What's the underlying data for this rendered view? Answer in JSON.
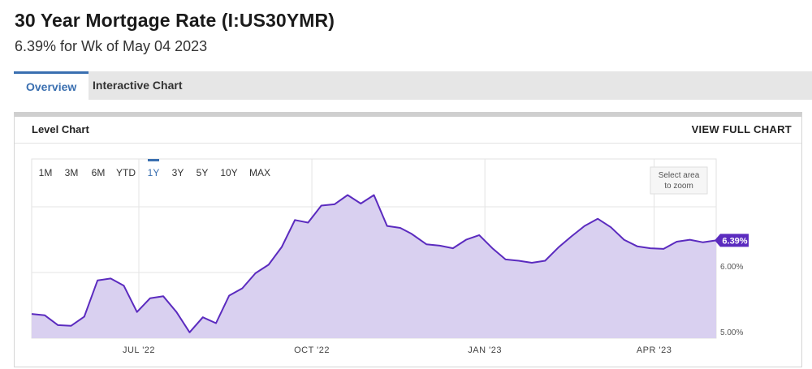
{
  "header": {
    "title": "30 Year Mortgage Rate (I:US30YMR)",
    "subtitle": "6.39% for Wk of May 04 2023"
  },
  "tabs": [
    {
      "label": "Overview",
      "active": true
    },
    {
      "label": "Interactive Chart",
      "active": false
    }
  ],
  "panel": {
    "title": "Level Chart",
    "view_full_label": "VIEW FULL CHART"
  },
  "zoom_hint": [
    "Select area",
    "to zoom"
  ],
  "range_buttons": [
    {
      "label": "1M",
      "active": false
    },
    {
      "label": "3M",
      "active": false
    },
    {
      "label": "6M",
      "active": false
    },
    {
      "label": "YTD",
      "active": false
    },
    {
      "label": "1Y",
      "active": true
    },
    {
      "label": "3Y",
      "active": false
    },
    {
      "label": "5Y",
      "active": false
    },
    {
      "label": "10Y",
      "active": false
    },
    {
      "label": "MAX",
      "active": false
    }
  ],
  "colors": {
    "line": "#5b2bbf",
    "fill": "#d9d0f0",
    "active_tab": "#3a6fb0",
    "badge": "#5b2bbf"
  },
  "chart_data": {
    "type": "area",
    "title": "",
    "xlabel": "",
    "ylabel": "",
    "last_value_label": "6.39%",
    "x_ticks": [
      "JUL '22",
      "OCT '22",
      "JAN '23",
      "APR '23"
    ],
    "y_ticks": [
      "5.00%",
      "6.00%"
    ],
    "ylim": [
      5.0,
      7.0
    ],
    "series": [
      {
        "x": [
          "2022-05-05",
          "2022-05-12",
          "2022-05-19",
          "2022-05-26",
          "2022-06-02",
          "2022-06-09",
          "2022-06-16",
          "2022-06-23",
          "2022-06-30",
          "2022-07-07",
          "2022-07-14",
          "2022-07-21",
          "2022-07-28",
          "2022-08-04",
          "2022-08-11",
          "2022-08-18",
          "2022-08-25",
          "2022-09-01",
          "2022-09-08",
          "2022-09-15",
          "2022-09-22",
          "2022-09-29",
          "2022-10-06",
          "2022-10-13",
          "2022-10-20",
          "2022-10-27",
          "2022-11-03",
          "2022-11-10",
          "2022-11-17",
          "2022-11-23",
          "2022-12-01",
          "2022-12-08",
          "2022-12-15",
          "2022-12-22",
          "2022-12-29",
          "2023-01-05",
          "2023-01-12",
          "2023-01-19",
          "2023-01-26",
          "2023-02-02",
          "2023-02-09",
          "2023-02-16",
          "2023-02-23",
          "2023-03-02",
          "2023-03-09",
          "2023-03-16",
          "2023-03-23",
          "2023-03-30",
          "2023-04-06",
          "2023-04-13",
          "2023-04-20",
          "2023-04-27",
          "2023-05-04"
        ],
        "values": [
          5.27,
          5.25,
          5.1,
          5.09,
          5.23,
          5.78,
          5.81,
          5.7,
          5.3,
          5.51,
          5.54,
          5.3,
          4.99,
          5.22,
          5.13,
          5.55,
          5.66,
          5.89,
          6.02,
          6.29,
          6.7,
          6.66,
          6.92,
          6.94,
          7.08,
          6.95,
          7.08,
          6.61,
          6.58,
          6.49,
          6.33,
          6.31,
          6.27,
          6.4,
          6.47,
          6.27,
          6.1,
          6.08,
          6.05,
          6.08,
          6.28,
          6.45,
          6.61,
          6.72,
          6.59,
          6.4,
          6.3,
          6.27,
          6.26,
          6.37,
          6.4,
          6.36,
          6.39
        ]
      }
    ]
  }
}
